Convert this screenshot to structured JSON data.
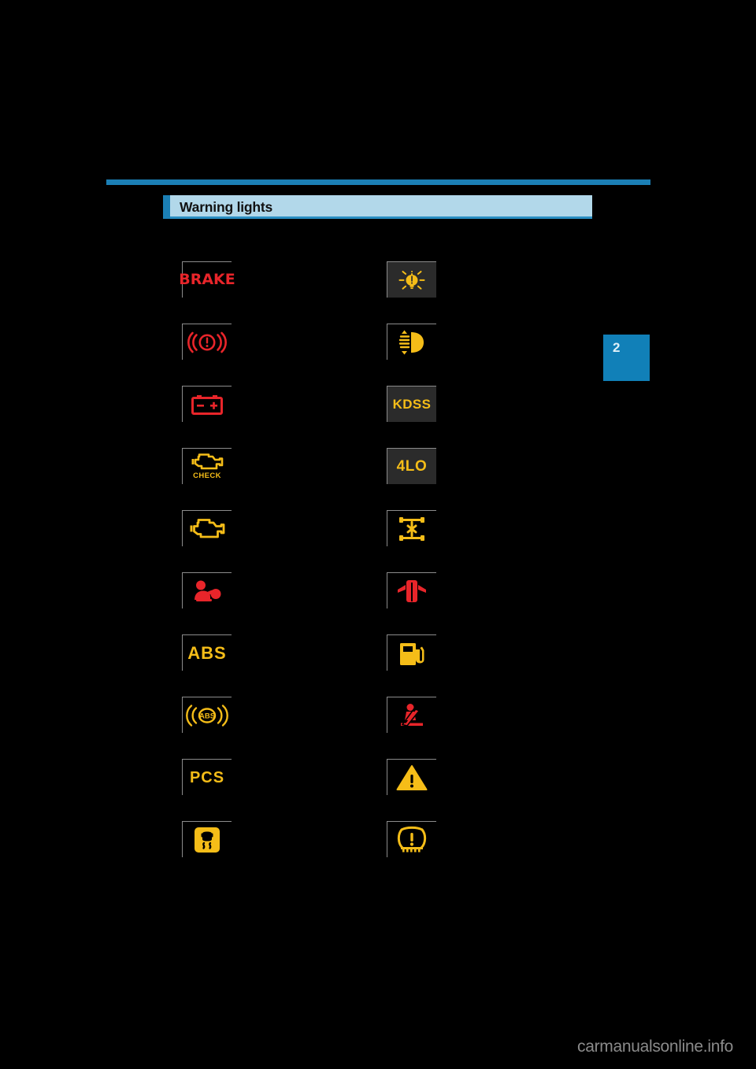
{
  "page": {
    "background_color": "#000000",
    "chapter_tab": {
      "number": "2",
      "color": "#1180b8"
    },
    "watermark": "carmanualsonline.info"
  },
  "header": {
    "title": "Warning lights",
    "bar_color": "#b2d8ea",
    "accent_color": "#1b7fb5",
    "rule_color": "#1b7fb5"
  },
  "colors": {
    "warning_red": "#e8252a",
    "warning_amber": "#f5bd18",
    "cell_border": "#8c8c8c",
    "boxed_background": "#2b2b2b"
  },
  "warning_lights": {
    "column_left": [
      {
        "id": "brake-system-warning",
        "type": "text",
        "label": "BRAKE",
        "color": "#e8252a",
        "boxed": false
      },
      {
        "id": "brake-circle-warning",
        "type": "icon",
        "icon": "brake-circle-icon",
        "label": "",
        "color": "#e8252a",
        "boxed": false
      },
      {
        "id": "charging-system-warning",
        "type": "icon",
        "icon": "battery-icon",
        "label": "",
        "color": "#e8252a",
        "boxed": false
      },
      {
        "id": "check-engine-warning",
        "type": "icon",
        "icon": "engine-check-icon",
        "label": "CHECK",
        "color": "#f5bd18",
        "boxed": false
      },
      {
        "id": "malfunction-indicator",
        "type": "icon",
        "icon": "engine-icon",
        "label": "",
        "color": "#f5bd18",
        "boxed": false
      },
      {
        "id": "srs-airbag-warning",
        "type": "icon",
        "icon": "airbag-icon",
        "label": "",
        "color": "#e8252a",
        "boxed": false
      },
      {
        "id": "abs-warning",
        "type": "text",
        "label": "ABS",
        "color": "#f5bd18",
        "boxed": false
      },
      {
        "id": "brake-assist-warning",
        "type": "icon",
        "icon": "abs-waves-icon",
        "label": "ABS",
        "color": "#f5bd18",
        "boxed": false
      },
      {
        "id": "pcs-warning",
        "type": "text",
        "label": "PCS",
        "color": "#f5bd18",
        "boxed": false
      },
      {
        "id": "slip-indicator",
        "type": "icon",
        "icon": "vsc-slip-icon",
        "label": "",
        "color": "#f5bd18",
        "boxed": false
      }
    ],
    "column_right": [
      {
        "id": "light-failure-indicator",
        "type": "icon",
        "icon": "bulb-failure-icon",
        "label": "",
        "color": "#f5bd18",
        "boxed": true
      },
      {
        "id": "headlight-leveling-warning",
        "type": "icon",
        "icon": "headlight-leveling-icon",
        "label": "",
        "color": "#f5bd18",
        "boxed": false
      },
      {
        "id": "kdss-warning",
        "type": "text",
        "label": "KDSS",
        "color": "#f5bd18",
        "boxed": true
      },
      {
        "id": "low-range-indicator",
        "type": "text",
        "label": "4LO",
        "color": "#f5bd18",
        "boxed": true
      },
      {
        "id": "differential-lock-indicator",
        "type": "icon",
        "icon": "axle-lock-icon",
        "label": "",
        "color": "#f5bd18",
        "boxed": false
      },
      {
        "id": "door-open-warning",
        "type": "icon",
        "icon": "door-open-icon",
        "label": "",
        "color": "#e8252a",
        "boxed": false
      },
      {
        "id": "low-fuel-warning",
        "type": "icon",
        "icon": "fuel-pump-icon",
        "label": "",
        "color": "#f5bd18",
        "boxed": false
      },
      {
        "id": "seat-belt-reminder",
        "type": "icon",
        "icon": "seatbelt-icon",
        "label": "",
        "color": "#e8252a",
        "boxed": false
      },
      {
        "id": "master-warning",
        "type": "icon",
        "icon": "warning-triangle-icon",
        "label": "",
        "color": "#f5bd18",
        "boxed": false
      },
      {
        "id": "tire-pressure-warning",
        "type": "icon",
        "icon": "tpms-icon",
        "label": "",
        "color": "#f5bd18",
        "boxed": false
      }
    ]
  }
}
